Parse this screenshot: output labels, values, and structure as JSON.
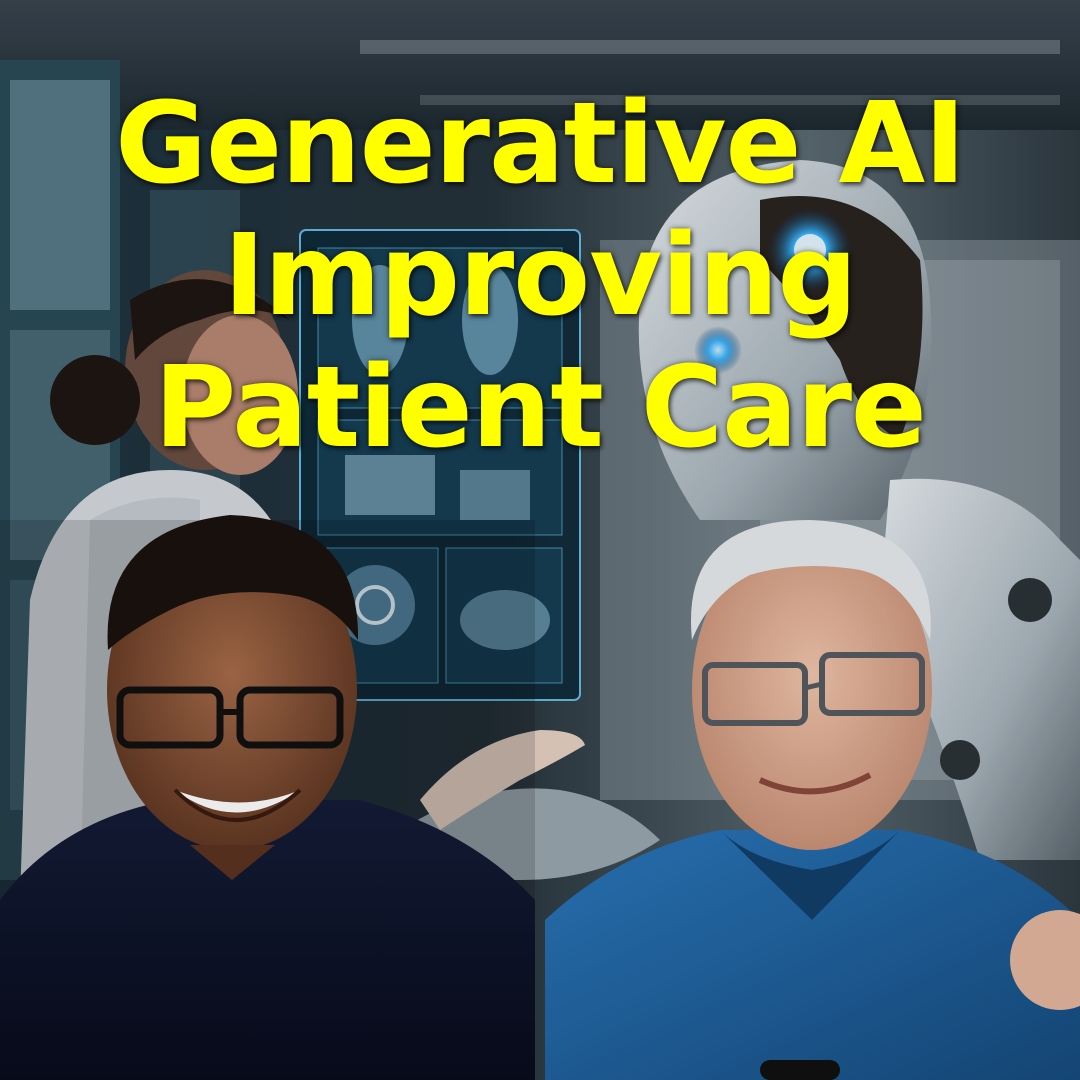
{
  "headline": {
    "lines": [
      "Generative AI",
      "Improving",
      "Patient Care"
    ],
    "color": "#ffff00"
  },
  "scene": {
    "background_color": "#1a2a36",
    "hologram_color": "#6fd3ff",
    "robot_eye_color": "#2fa8ff",
    "left_person_shirt_color": "#0d1630",
    "right_person_shirt_color": "#1d5e9a"
  }
}
